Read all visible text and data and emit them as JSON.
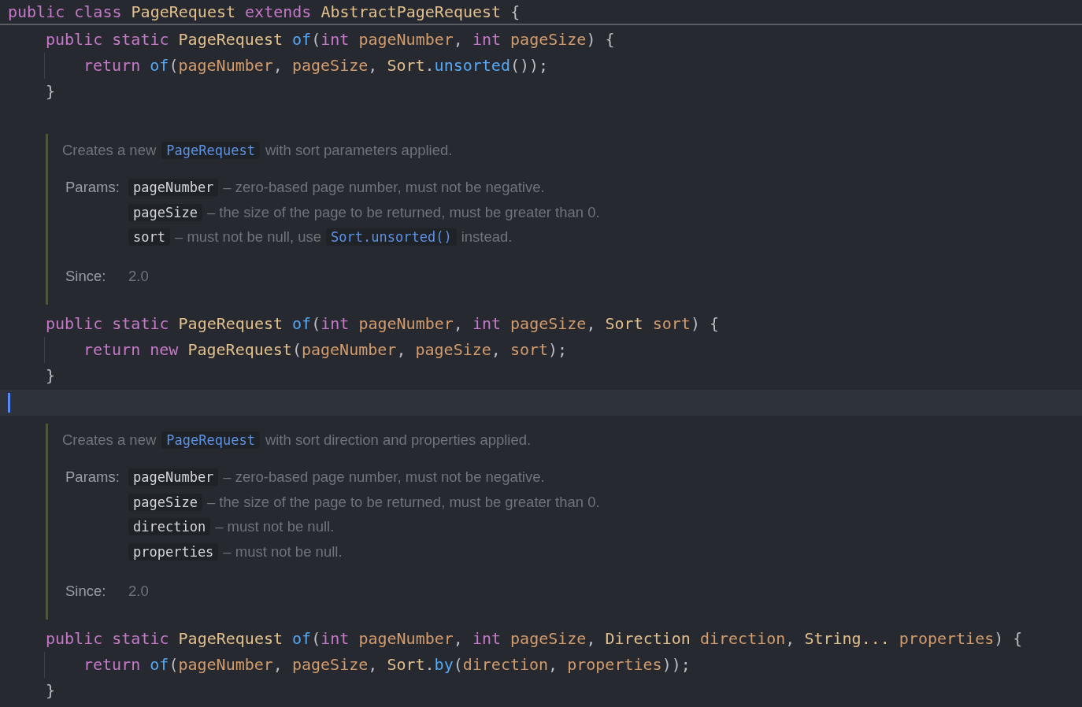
{
  "header_line": [
    {
      "kind": "kw",
      "t": "public class "
    },
    {
      "kind": "type",
      "t": "PageRequest "
    },
    {
      "kind": "kw",
      "t": "extends "
    },
    {
      "kind": "type",
      "t": "AbstractPageRequest "
    },
    {
      "kind": "p",
      "t": "{"
    }
  ],
  "items": [
    {
      "kind": "code",
      "guide": false,
      "tokens": [
        {
          "kind": "kw",
          "t": "public static "
        },
        {
          "kind": "type",
          "t": "PageRequest "
        },
        {
          "kind": "fn",
          "t": "of"
        },
        {
          "kind": "p",
          "t": "("
        },
        {
          "kind": "kw",
          "t": "int "
        },
        {
          "kind": "param",
          "t": "pageNumber"
        },
        {
          "kind": "p",
          "t": ", "
        },
        {
          "kind": "kw",
          "t": "int "
        },
        {
          "kind": "param",
          "t": "pageSize"
        },
        {
          "kind": "p",
          "t": ") {"
        }
      ]
    },
    {
      "kind": "code",
      "guide": true,
      "tokens": [
        {
          "kind": "kw",
          "t": "return "
        },
        {
          "kind": "fn",
          "t": "of"
        },
        {
          "kind": "p",
          "t": "("
        },
        {
          "kind": "param",
          "t": "pageNumber"
        },
        {
          "kind": "p",
          "t": ", "
        },
        {
          "kind": "param",
          "t": "pageSize"
        },
        {
          "kind": "p",
          "t": ", "
        },
        {
          "kind": "type",
          "t": "Sort"
        },
        {
          "kind": "p",
          "t": "."
        },
        {
          "kind": "fn",
          "t": "unsorted"
        },
        {
          "kind": "p",
          "t": "());"
        }
      ]
    },
    {
      "kind": "code",
      "guide": false,
      "tokens": [
        {
          "kind": "p",
          "t": "}"
        }
      ]
    },
    {
      "kind": "blank"
    },
    {
      "kind": "doc",
      "description": [
        {
          "kind": "text",
          "t": "Creates a new"
        },
        {
          "kind": "code",
          "t": "PageRequest"
        },
        {
          "kind": "text",
          "t": "with sort parameters applied."
        }
      ],
      "params_label": "Params:",
      "params": [
        {
          "name": "pageNumber",
          "desc": [
            {
              "kind": "text",
              "t": "– zero-based page number, must not be negative."
            }
          ]
        },
        {
          "name": "pageSize",
          "desc": [
            {
              "kind": "text",
              "t": "– the size of the page to be returned, must be greater than 0."
            }
          ]
        },
        {
          "name": "sort",
          "desc": [
            {
              "kind": "text",
              "t": "– must not be null, use"
            },
            {
              "kind": "code",
              "t": "Sort.unsorted()"
            },
            {
              "kind": "text",
              "t": "instead."
            }
          ]
        }
      ],
      "since_label": "Since:",
      "since": "2.0"
    },
    {
      "kind": "code",
      "guide": false,
      "tokens": [
        {
          "kind": "kw",
          "t": "public static "
        },
        {
          "kind": "type",
          "t": "PageRequest "
        },
        {
          "kind": "fn",
          "t": "of"
        },
        {
          "kind": "p",
          "t": "("
        },
        {
          "kind": "kw",
          "t": "int "
        },
        {
          "kind": "param",
          "t": "pageNumber"
        },
        {
          "kind": "p",
          "t": ", "
        },
        {
          "kind": "kw",
          "t": "int "
        },
        {
          "kind": "param",
          "t": "pageSize"
        },
        {
          "kind": "p",
          "t": ", "
        },
        {
          "kind": "type",
          "t": "Sort "
        },
        {
          "kind": "param",
          "t": "sort"
        },
        {
          "kind": "p",
          "t": ") {"
        }
      ]
    },
    {
      "kind": "code",
      "guide": true,
      "tokens": [
        {
          "kind": "kw",
          "t": "return new "
        },
        {
          "kind": "type",
          "t": "PageRequest"
        },
        {
          "kind": "p",
          "t": "("
        },
        {
          "kind": "param",
          "t": "pageNumber"
        },
        {
          "kind": "p",
          "t": ", "
        },
        {
          "kind": "param",
          "t": "pageSize"
        },
        {
          "kind": "p",
          "t": ", "
        },
        {
          "kind": "param",
          "t": "sort"
        },
        {
          "kind": "p",
          "t": ");"
        }
      ]
    },
    {
      "kind": "code",
      "guide": false,
      "tokens": [
        {
          "kind": "p",
          "t": "}"
        }
      ]
    },
    {
      "kind": "current_line"
    },
    {
      "kind": "doc",
      "description": [
        {
          "kind": "text",
          "t": "Creates a new"
        },
        {
          "kind": "code",
          "t": "PageRequest"
        },
        {
          "kind": "text",
          "t": "with sort direction and properties applied."
        }
      ],
      "params_label": "Params:",
      "params": [
        {
          "name": "pageNumber",
          "desc": [
            {
              "kind": "text",
              "t": "– zero-based page number, must not be negative."
            }
          ]
        },
        {
          "name": "pageSize",
          "desc": [
            {
              "kind": "text",
              "t": "– the size of the page to be returned, must be greater than 0."
            }
          ]
        },
        {
          "name": "direction",
          "desc": [
            {
              "kind": "text",
              "t": "– must not be null."
            }
          ]
        },
        {
          "name": "properties",
          "desc": [
            {
              "kind": "text",
              "t": "– must not be null."
            }
          ]
        }
      ],
      "since_label": "Since:",
      "since": "2.0"
    },
    {
      "kind": "code",
      "guide": false,
      "tokens": [
        {
          "kind": "kw",
          "t": "public static "
        },
        {
          "kind": "type",
          "t": "PageRequest "
        },
        {
          "kind": "fn",
          "t": "of"
        },
        {
          "kind": "p",
          "t": "("
        },
        {
          "kind": "kw",
          "t": "int "
        },
        {
          "kind": "param",
          "t": "pageNumber"
        },
        {
          "kind": "p",
          "t": ", "
        },
        {
          "kind": "kw",
          "t": "int "
        },
        {
          "kind": "param",
          "t": "pageSize"
        },
        {
          "kind": "p",
          "t": ", "
        },
        {
          "kind": "type",
          "t": "Direction "
        },
        {
          "kind": "param",
          "t": "direction"
        },
        {
          "kind": "p",
          "t": ", "
        },
        {
          "kind": "type",
          "t": "String... "
        },
        {
          "kind": "param",
          "t": "properties"
        },
        {
          "kind": "p",
          "t": ") {"
        }
      ]
    },
    {
      "kind": "code",
      "guide": true,
      "tokens": [
        {
          "kind": "kw",
          "t": "return "
        },
        {
          "kind": "fn",
          "t": "of"
        },
        {
          "kind": "p",
          "t": "("
        },
        {
          "kind": "param",
          "t": "pageNumber"
        },
        {
          "kind": "p",
          "t": ", "
        },
        {
          "kind": "param",
          "t": "pageSize"
        },
        {
          "kind": "p",
          "t": ", "
        },
        {
          "kind": "type",
          "t": "Sort"
        },
        {
          "kind": "p",
          "t": "."
        },
        {
          "kind": "fn",
          "t": "by"
        },
        {
          "kind": "p",
          "t": "("
        },
        {
          "kind": "param",
          "t": "direction"
        },
        {
          "kind": "p",
          "t": ", "
        },
        {
          "kind": "param",
          "t": "properties"
        },
        {
          "kind": "p",
          "t": "));"
        }
      ]
    },
    {
      "kind": "code",
      "guide": false,
      "tokens": [
        {
          "kind": "p",
          "t": "}"
        }
      ]
    }
  ]
}
